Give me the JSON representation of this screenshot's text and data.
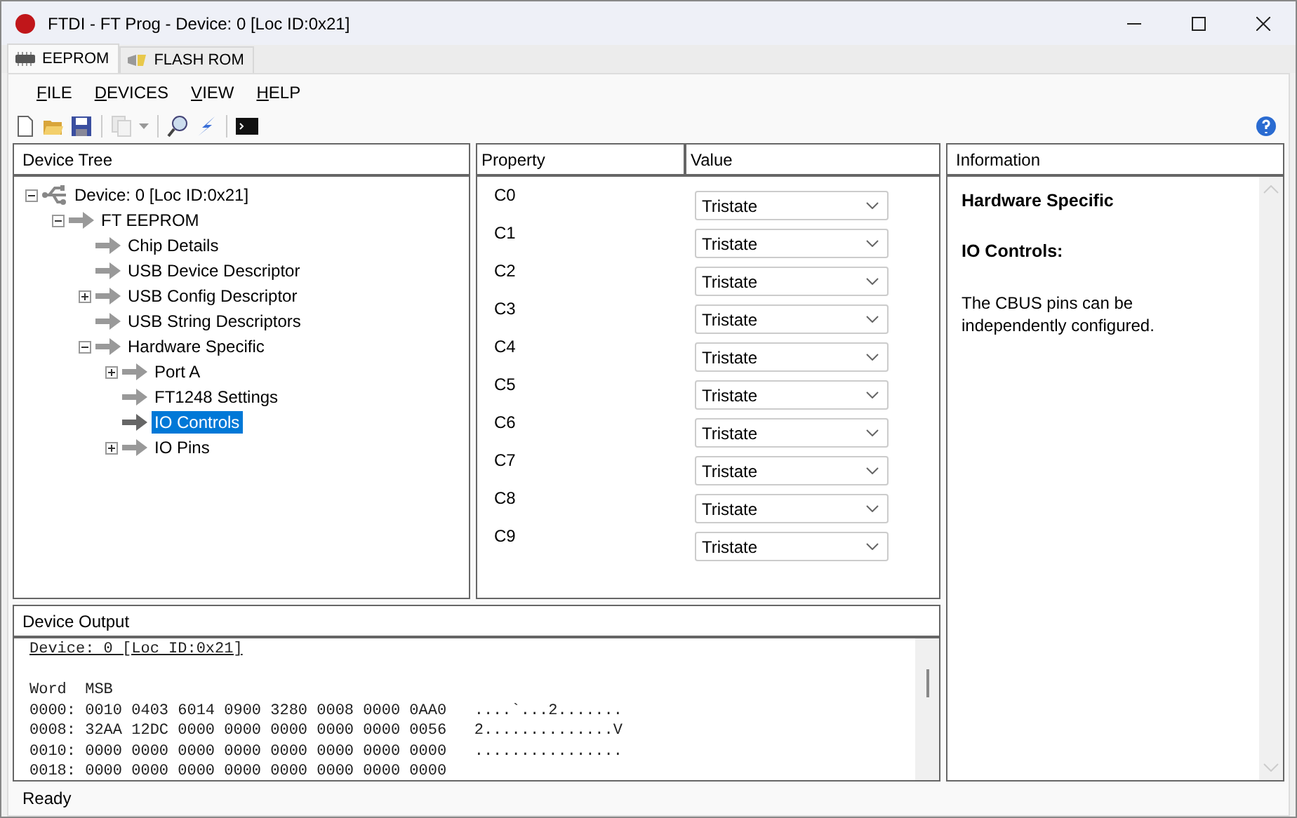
{
  "window": {
    "title": "FTDI - FT Prog - Device: 0 [Loc ID:0x21]"
  },
  "tabs": [
    {
      "label": "EEPROM",
      "selected": true,
      "kind": "chip"
    },
    {
      "label": "FLASH ROM",
      "selected": false,
      "kind": "flash"
    }
  ],
  "menu": [
    "FILE",
    "DEVICES",
    "VIEW",
    "HELP"
  ],
  "device_tree": {
    "title": "Device Tree",
    "items": [
      {
        "label": "Device: 0 [Loc ID:0x21]",
        "kind": "device",
        "expanded": true,
        "selected": false,
        "children": [
          {
            "label": "FT EEPROM",
            "kind": "node",
            "expanded": true,
            "selected": false,
            "children": [
              {
                "label": "Chip Details",
                "kind": "node",
                "selected": false
              },
              {
                "label": "USB Device Descriptor",
                "kind": "node",
                "selected": false
              },
              {
                "label": "USB Config Descriptor",
                "kind": "node",
                "expanded": false,
                "selected": false
              },
              {
                "label": "USB String Descriptors",
                "kind": "node",
                "selected": false
              },
              {
                "label": "Hardware Specific",
                "kind": "node",
                "expanded": true,
                "selected": false,
                "children": [
                  {
                    "label": "Port A",
                    "kind": "node",
                    "expanded": false,
                    "selected": false
                  },
                  {
                    "label": "FT1248 Settings",
                    "kind": "node",
                    "selected": false
                  },
                  {
                    "label": "IO Controls",
                    "kind": "node",
                    "selected": true
                  },
                  {
                    "label": "IO Pins",
                    "kind": "node",
                    "expanded": false,
                    "selected": false
                  }
                ]
              }
            ]
          }
        ]
      }
    ]
  },
  "properties": {
    "columns": [
      "Property",
      "Value"
    ],
    "rows": [
      {
        "name": "C0",
        "value": "Tristate"
      },
      {
        "name": "C1",
        "value": "Tristate"
      },
      {
        "name": "C2",
        "value": "Tristate"
      },
      {
        "name": "C3",
        "value": "Tristate"
      },
      {
        "name": "C4",
        "value": "Tristate"
      },
      {
        "name": "C5",
        "value": "Tristate"
      },
      {
        "name": "C6",
        "value": "Tristate"
      },
      {
        "name": "C7",
        "value": "Tristate"
      },
      {
        "name": "C8",
        "value": "Tristate"
      },
      {
        "name": "C9",
        "value": "Tristate"
      }
    ]
  },
  "information": {
    "title": "Information",
    "heading": "Hardware Specific",
    "subheading": "IO Controls:",
    "text": "The CBUS pins can be independently configured."
  },
  "device_output": {
    "title": "Device Output",
    "device_link": "Device: 0 [Loc ID:0x21]",
    "lines": [
      "Word  MSB",
      "0000: 0010 0403 6014 0900 3280 0008 0000 0AA0   ....`...2.......",
      "0008: 32AA 12DC 0000 0000 0000 0000 0000 0056   2..............V",
      "0010: 0000 0000 0000 0000 0000 0000 0000 0000   ................",
      "0018: 0000 0000 0000 0000 0000 0000 0000 0000"
    ]
  },
  "status_bar": {
    "text": "Ready"
  }
}
